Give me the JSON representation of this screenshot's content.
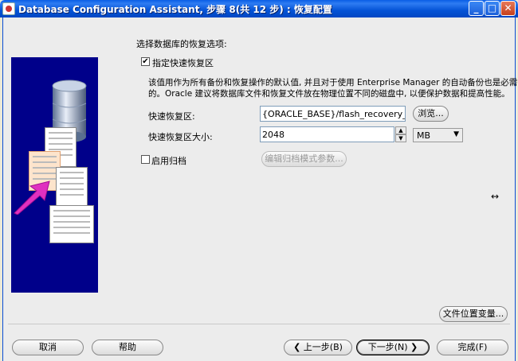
{
  "window": {
    "title": "Database Configuration Assistant, 步骤 8(共 12 步) : 恢复配置",
    "minimize": "_",
    "maximize": "□",
    "close": "✕"
  },
  "main": {
    "section_title": "选择数据库的恢复选项:",
    "fast_recovery_checkbox": "指定快速恢复区",
    "fast_recovery_checked": "✔",
    "description_line1": "该值用作为所有备份和恢复操作的默认值, 并且对于使用 Enterprise Manager 的自动备份也是必需",
    "description_line2": "的。Oracle 建议将数据库文件和恢复文件放在物理位置不同的磁盘中, 以便保护数据和提高性能。",
    "fra_label": "快速恢复区:",
    "fra_value": "{ORACLE_BASE}/flash_recovery_area",
    "browse_button": "浏览...",
    "fra_size_label": "快速恢复区大小:",
    "fra_size_value": "2048",
    "fra_size_unit": "MB",
    "archive_checkbox": "启用归档",
    "archive_params_button": "编辑归档模式参数...",
    "file_location_button": "文件位置变量..."
  },
  "footer": {
    "cancel": "取消",
    "help": "帮助",
    "back": "上一步(B)",
    "next": "下一步(N)",
    "finish": "完成(F)"
  }
}
